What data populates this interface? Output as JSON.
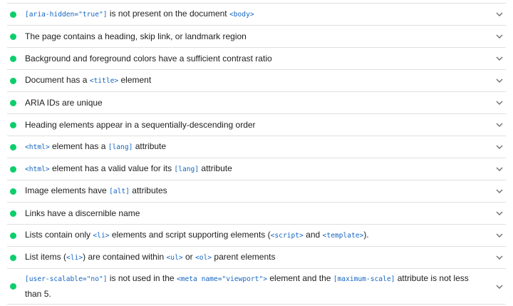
{
  "audits": [
    {
      "status": "pass",
      "parts": [
        {
          "t": "code",
          "v": "[aria-hidden=\"true\"]"
        },
        {
          "t": "text",
          "v": " is not present on the document "
        },
        {
          "t": "code",
          "v": "<body>"
        }
      ]
    },
    {
      "status": "pass",
      "parts": [
        {
          "t": "text",
          "v": "The page contains a heading, skip link, or landmark region"
        }
      ]
    },
    {
      "status": "pass",
      "parts": [
        {
          "t": "text",
          "v": "Background and foreground colors have a sufficient contrast ratio"
        }
      ]
    },
    {
      "status": "pass",
      "parts": [
        {
          "t": "text",
          "v": "Document has a "
        },
        {
          "t": "code",
          "v": "<title>"
        },
        {
          "t": "text",
          "v": " element"
        }
      ]
    },
    {
      "status": "pass",
      "parts": [
        {
          "t": "text",
          "v": "ARIA IDs are unique"
        }
      ]
    },
    {
      "status": "pass",
      "parts": [
        {
          "t": "text",
          "v": "Heading elements appear in a sequentially-descending order"
        }
      ]
    },
    {
      "status": "pass",
      "parts": [
        {
          "t": "code",
          "v": "<html>"
        },
        {
          "t": "text",
          "v": " element has a "
        },
        {
          "t": "code",
          "v": "[lang]"
        },
        {
          "t": "text",
          "v": " attribute"
        }
      ]
    },
    {
      "status": "pass",
      "parts": [
        {
          "t": "code",
          "v": "<html>"
        },
        {
          "t": "text",
          "v": " element has a valid value for its "
        },
        {
          "t": "code",
          "v": "[lang]"
        },
        {
          "t": "text",
          "v": " attribute"
        }
      ]
    },
    {
      "status": "pass",
      "parts": [
        {
          "t": "text",
          "v": "Image elements have "
        },
        {
          "t": "code",
          "v": "[alt]"
        },
        {
          "t": "text",
          "v": " attributes"
        }
      ]
    },
    {
      "status": "pass",
      "parts": [
        {
          "t": "text",
          "v": "Links have a discernible name"
        }
      ]
    },
    {
      "status": "pass",
      "parts": [
        {
          "t": "text",
          "v": "Lists contain only "
        },
        {
          "t": "code",
          "v": "<li>"
        },
        {
          "t": "text",
          "v": " elements and script supporting elements ("
        },
        {
          "t": "code",
          "v": "<script>"
        },
        {
          "t": "text",
          "v": " and "
        },
        {
          "t": "code",
          "v": "<template>"
        },
        {
          "t": "text",
          "v": ")."
        }
      ]
    },
    {
      "status": "pass",
      "parts": [
        {
          "t": "text",
          "v": "List items ("
        },
        {
          "t": "code",
          "v": "<li>"
        },
        {
          "t": "text",
          "v": ") are contained within "
        },
        {
          "t": "code",
          "v": "<ul>"
        },
        {
          "t": "text",
          "v": " or "
        },
        {
          "t": "code",
          "v": "<ol>"
        },
        {
          "t": "text",
          "v": " parent elements"
        }
      ]
    },
    {
      "status": "pass",
      "tall": true,
      "parts": [
        {
          "t": "code",
          "v": "[user-scalable=\"no\"]"
        },
        {
          "t": "text",
          "v": " is not used in the "
        },
        {
          "t": "code",
          "v": "<meta name=\"viewport\">"
        },
        {
          "t": "text",
          "v": " element and the "
        },
        {
          "t": "code",
          "v": "[maximum-scale]"
        },
        {
          "t": "text",
          "v": " attribute is not less than 5."
        }
      ]
    }
  ],
  "colors": {
    "pass": "#0cce6b",
    "code": "#1565c0",
    "divider": "#e0e0e0"
  },
  "icons": {
    "status": "pass-circle-icon",
    "expand": "chevron-down-icon"
  }
}
